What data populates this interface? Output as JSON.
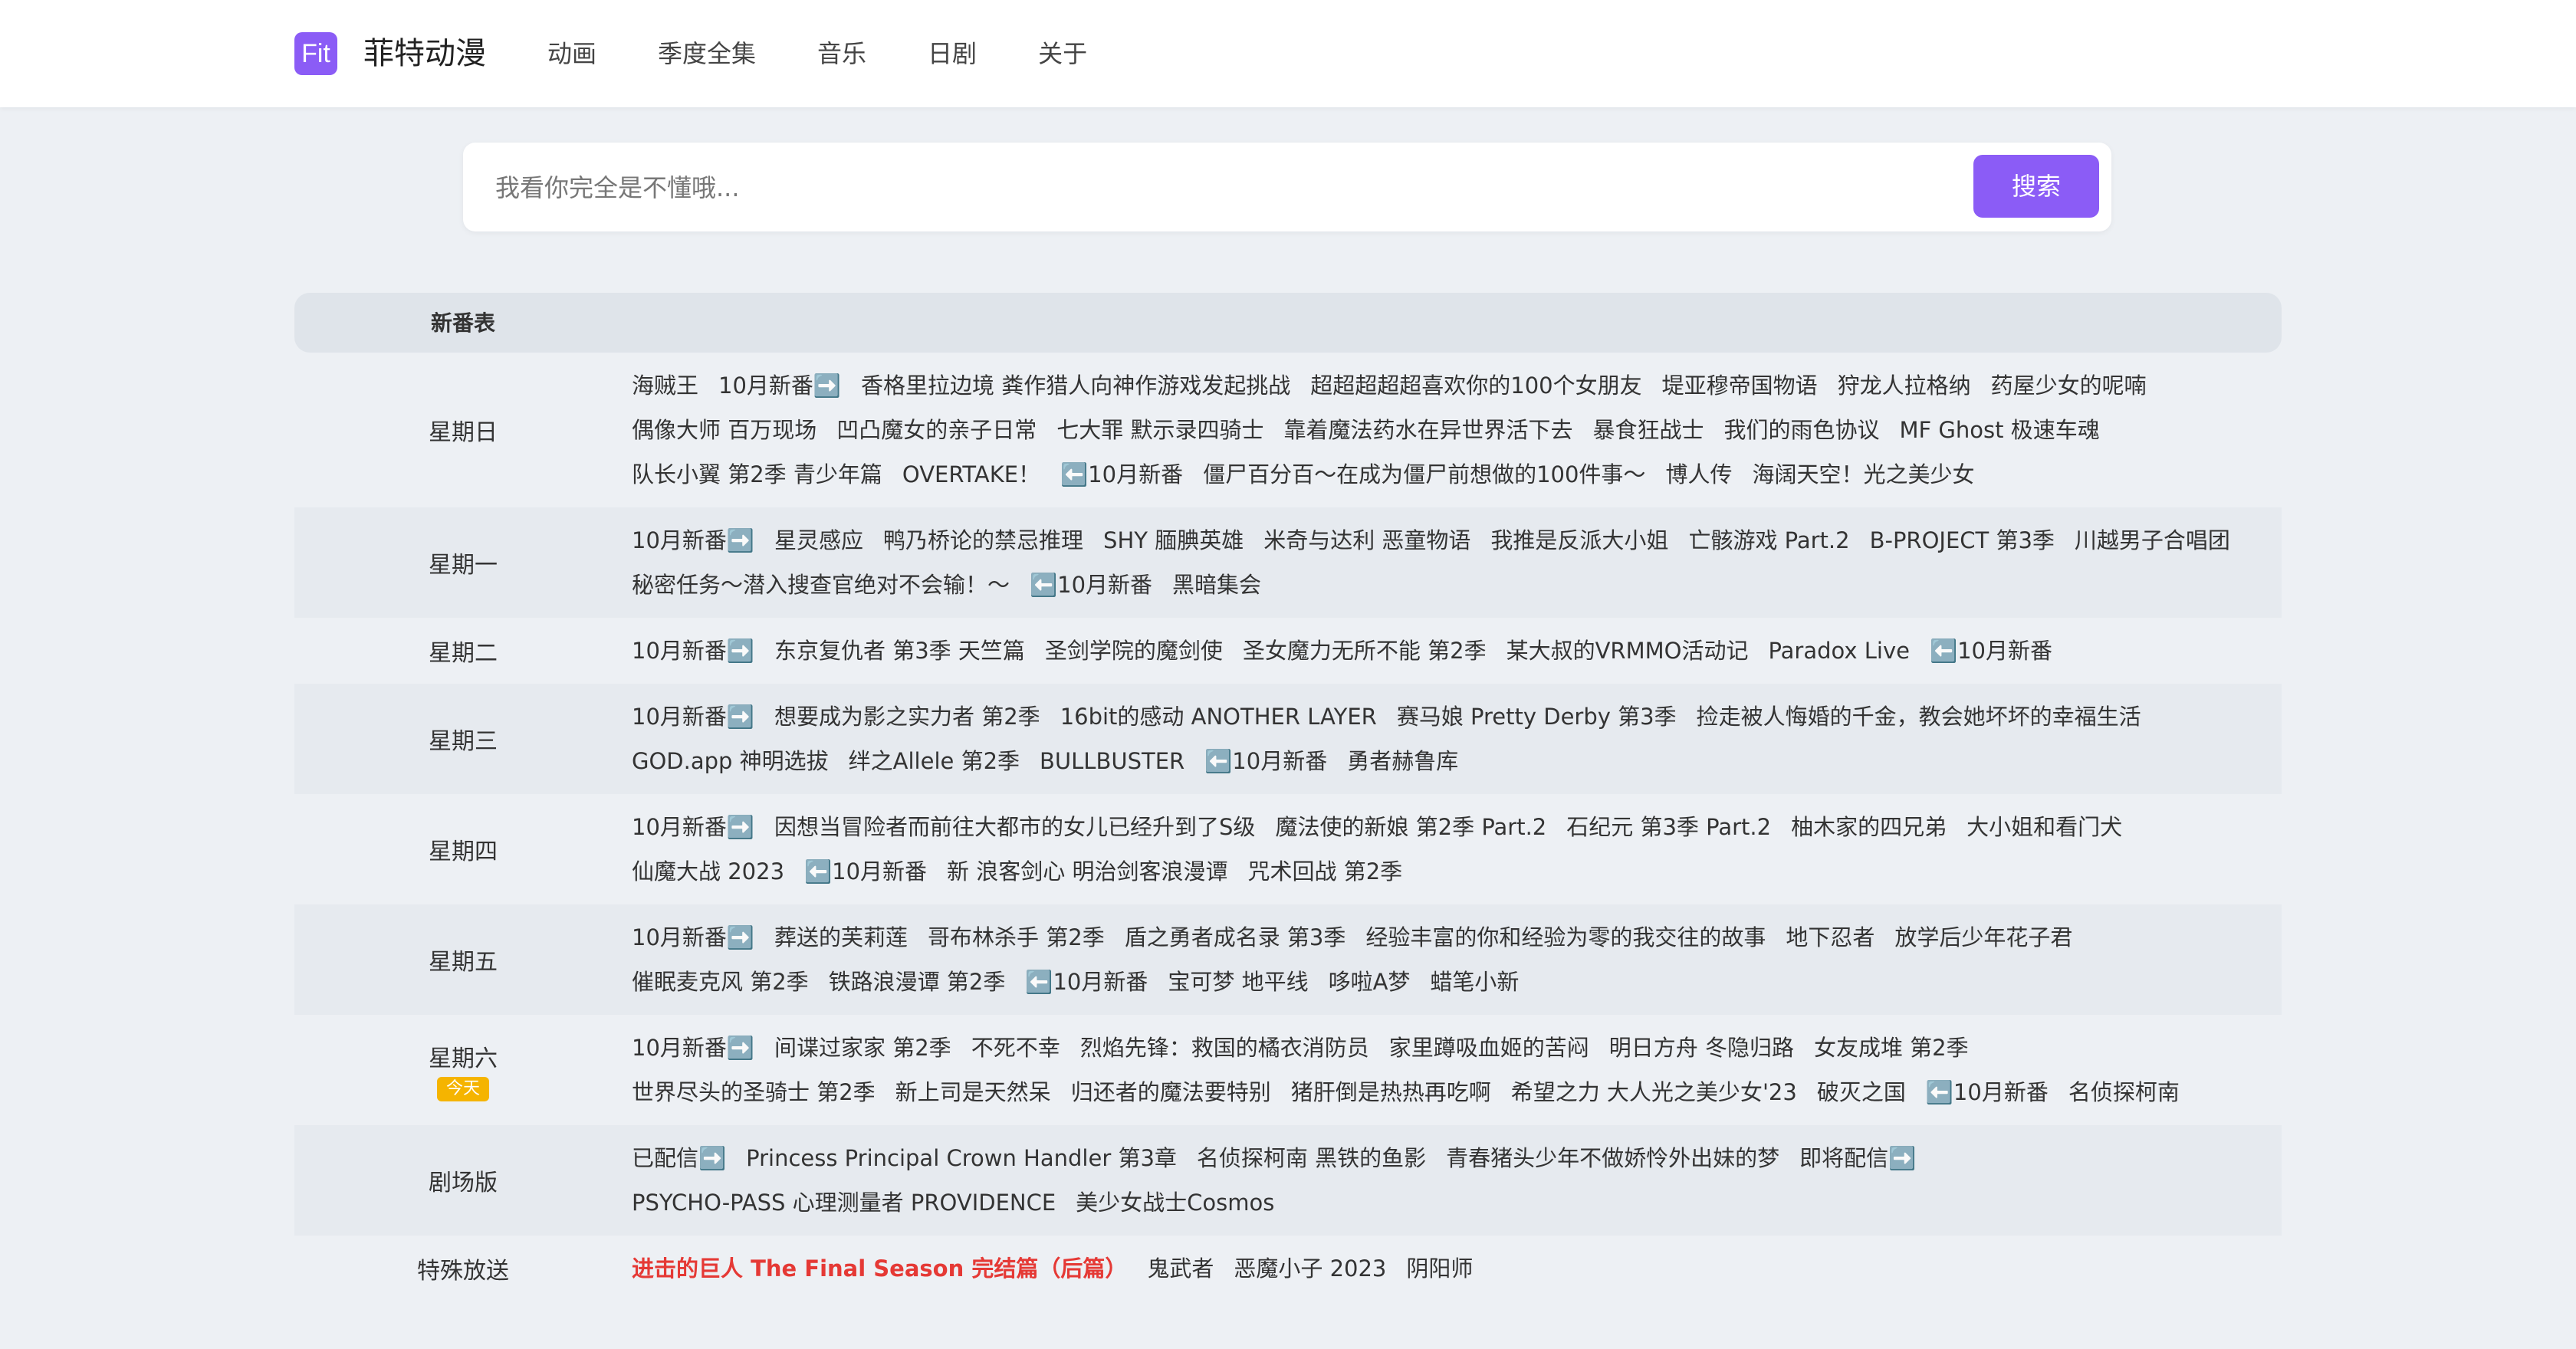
{
  "header": {
    "logo_text": "Fit",
    "site_name": "菲特动漫",
    "nav": [
      "动画",
      "季度全集",
      "音乐",
      "日剧",
      "关于"
    ]
  },
  "search": {
    "placeholder": "我看你完全是不懂哦...",
    "button_label": "搜索"
  },
  "schedule": {
    "header_label": "新番表",
    "rows": [
      {
        "day": "星期日",
        "titles": [
          "海贼王",
          "10月新番➡️",
          "香格里拉边境 粪作猎人向神作游戏发起挑战",
          "超超超超超喜欢你的100个女朋友",
          "堤亚穆帝国物语",
          "狩龙人拉格纳",
          "药屋少女的呢喃",
          "偶像大师 百万现场",
          "凹凸魔女的亲子日常",
          "七大罪 默示录四骑士",
          "靠着魔法药水在异世界活下去",
          "暴食狂战士",
          "我们的雨色协议",
          "MF Ghost 极速车魂",
          "队长小翼 第2季 青少年篇",
          "OVERTAKE！",
          "⬅️10月新番",
          "僵尸百分百～在成为僵尸前想做的100件事～",
          "博人传",
          "海阔天空！光之美少女"
        ]
      },
      {
        "day": "星期一",
        "titles": [
          "10月新番➡️",
          "星灵感应",
          "鸭乃桥论的禁忌推理",
          "SHY 腼腆英雄",
          "米奇与达利 恶童物语",
          "我推是反派大小姐",
          "亡骸游戏 Part.2",
          "B-PROJECT 第3季",
          "川越男子合唱团",
          "秘密任务～潜入搜查官绝对不会输！～",
          "⬅️10月新番",
          "黑暗集会"
        ]
      },
      {
        "day": "星期二",
        "titles": [
          "10月新番➡️",
          "东京复仇者 第3季 天竺篇",
          "圣剑学院的魔剑使",
          "圣女魔力无所不能 第2季",
          "某大叔的VRMMO活动记",
          "Paradox Live",
          "⬅️10月新番"
        ]
      },
      {
        "day": "星期三",
        "titles": [
          "10月新番➡️",
          "想要成为影之实力者 第2季",
          "16bit的感动 ANOTHER LAYER",
          "赛马娘 Pretty Derby 第3季",
          "捡走被人悔婚的千金，教会她坏坏的幸福生活",
          "GOD.app 神明选拔",
          "绊之Allele 第2季",
          "BULLBUSTER",
          "⬅️10月新番",
          "勇者赫鲁库"
        ]
      },
      {
        "day": "星期四",
        "titles": [
          "10月新番➡️",
          "因想当冒险者而前往大都市的女儿已经升到了S级",
          "魔法使的新娘 第2季 Part.2",
          "石纪元 第3季 Part.2",
          "柚木家的四兄弟",
          "大小姐和看门犬",
          "仙魔大战 2023",
          "⬅️10月新番",
          "新 浪客剑心 明治剑客浪漫谭",
          "咒术回战 第2季"
        ]
      },
      {
        "day": "星期五",
        "titles": [
          "10月新番➡️",
          "葬送的芙莉莲",
          "哥布林杀手 第2季",
          "盾之勇者成名录 第3季",
          "经验丰富的你和经验为零的我交往的故事",
          "地下忍者",
          "放学后少年花子君",
          "催眠麦克风 第2季",
          "铁路浪漫谭 第2季",
          "⬅️10月新番",
          "宝可梦 地平线",
          "哆啦A梦",
          "蜡笔小新"
        ]
      },
      {
        "day": "星期六",
        "today": "今天",
        "titles": [
          "10月新番➡️",
          "间谍过家家 第2季",
          "不死不幸",
          "烈焰先锋：救国的橘衣消防员",
          "家里蹲吸血姬的苦闷",
          "明日方舟 冬隐归路",
          "女友成堆 第2季",
          "世界尽头的圣骑士 第2季",
          "新上司是天然呆",
          "归还者的魔法要特别",
          "猪肝倒是热热再吃啊",
          "希望之力 大人光之美少女'23",
          "破灭之国",
          "⬅️10月新番",
          "名侦探柯南"
        ]
      },
      {
        "day": "剧场版",
        "titles": [
          "已配信➡️",
          "Princess Principal Crown Handler 第3章",
          "名侦探柯南 黑铁的鱼影",
          "青春猪头少年不做娇怜外出妹的梦",
          "即将配信➡️",
          "PSYCHO-PASS 心理测量者 PROVIDENCE",
          "美少女战士Cosmos"
        ]
      },
      {
        "day": "特殊放送",
        "titles": [
          "进击的巨人 The Final Season 完结篇（后篇）",
          "鬼武者",
          "恶魔小子 2023",
          "阴阳师"
        ],
        "hot_index": 0
      }
    ]
  },
  "colors": {
    "accent": "#8b5cf6",
    "badge": "#f5b400",
    "hot_title": "#e53935"
  }
}
